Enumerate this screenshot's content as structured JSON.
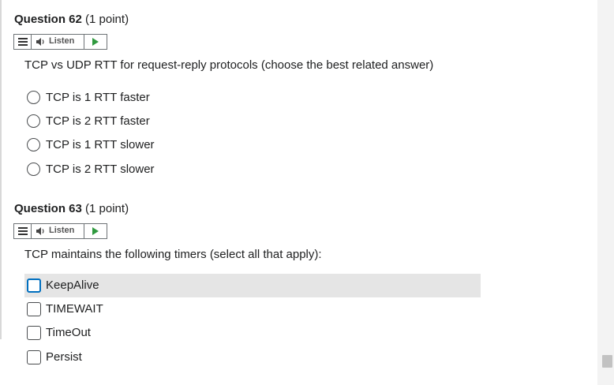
{
  "questions": [
    {
      "number": "Question 62",
      "points": "(1 point)",
      "listen_label": "Listen",
      "prompt": "TCP vs UDP RTT for request-reply protocols (choose the best related answer)",
      "input_type": "radio",
      "options": [
        "TCP is 1 RTT faster",
        "TCP is 2 RTT faster",
        "TCP is 1 RTT slower",
        "TCP is 2 RTT slower"
      ]
    },
    {
      "number": "Question 63",
      "points": "(1 point)",
      "listen_label": "Listen",
      "prompt": "TCP maintains the following timers (select all that apply):",
      "input_type": "checkbox",
      "options": [
        "KeepAlive",
        "TIMEWAIT",
        "TimeOut",
        "Persist"
      ],
      "highlighted_option": "KeepAlive"
    }
  ],
  "colors": {
    "text": "#202122",
    "play_green": "#309a3f",
    "focus_blue": "#006fbf",
    "hover_bg": "#e5e5e5"
  }
}
